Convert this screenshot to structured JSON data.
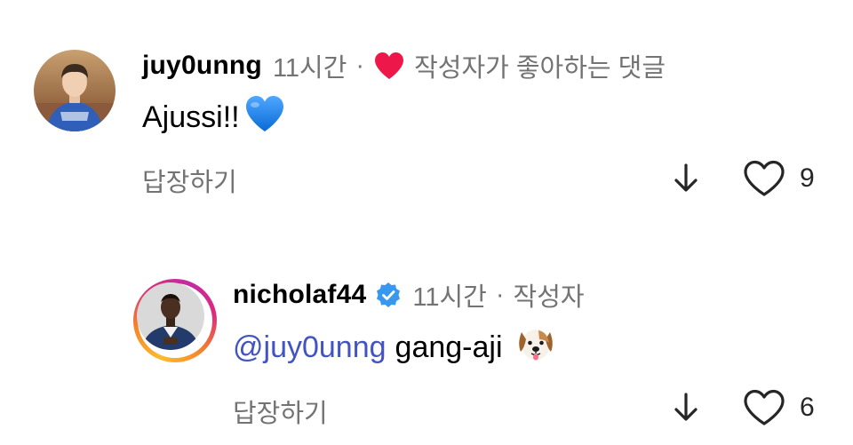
{
  "comments": [
    {
      "username": "juy0unng",
      "time": "11시간",
      "separator": "·",
      "liked_by_author_label": "작성자가 좋아하는 댓글",
      "text": "Ajussi!!",
      "reply_label": "답장하기",
      "like_count": "9",
      "icons": [
        "heart-liked-icon",
        "blue-heart-emoji",
        "down-arrow-icon",
        "heart-outline-icon"
      ]
    },
    {
      "username": "nicholaf44",
      "verified": true,
      "time": "11시간",
      "separator": "·",
      "author_label": "작성자",
      "mention": "@juy0unng",
      "text": "gang-aji",
      "reply_label": "답장하기",
      "like_count": "6",
      "icons": [
        "verified-badge-icon",
        "dog-face-emoji",
        "down-arrow-icon",
        "heart-outline-icon"
      ]
    }
  ],
  "colors": {
    "username": "#000000",
    "meta": "#737373",
    "mention": "#4353c4",
    "liked_heart": "#ed1849",
    "verified": "#3897f0",
    "blue_heart": "#1e88e5"
  }
}
